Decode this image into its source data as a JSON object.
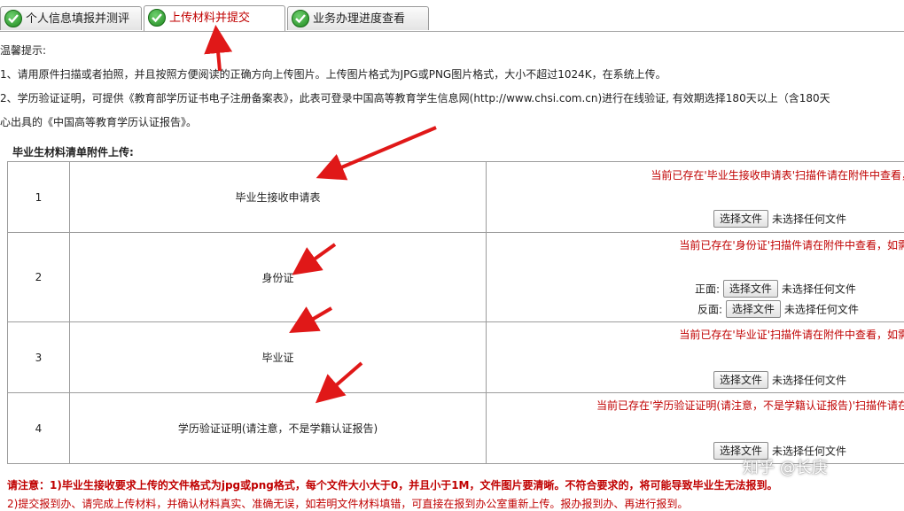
{
  "tabs": [
    {
      "label": "个人信息填报并测评",
      "active": false
    },
    {
      "label": "上传材料并提交",
      "active": true
    },
    {
      "label": "业务办理进度查看",
      "active": false
    }
  ],
  "notice": {
    "title": "温馨提示:",
    "line1": "1、请用原件扫描或者拍照，并且按照方便阅读的正确方向上传图片。上传图片格式为JPG或PNG图片格式，大小不超过1024K，在系统上传。",
    "line2": "2、学历验证证明，可提供《教育部学历证书电子注册备案表》，此表可登录中国高等教育学生信息网(http://www.chsi.com.cn)进行在线验证, 有效期选择180天以上（含180天",
    "line3": "心出具的《中国高等教育学历认证报告》。"
  },
  "section_title": "毕业生材料清单附件上传:",
  "rows": [
    {
      "num": "1",
      "name": "毕业生接收申请表",
      "exist": "当前已存在'毕业生接收申请表'扫描件请在附件中查看，",
      "button": "选择文件",
      "file": "未选择任何文件"
    },
    {
      "num": "2",
      "name": "身份证",
      "exist": "当前已存在'身份证'扫描件请在附件中查看，如需重",
      "front_label": "正面:",
      "back_label": "反面:",
      "button": "选择文件",
      "file": "未选择任何文件"
    },
    {
      "num": "3",
      "name": "毕业证",
      "exist": "当前已存在'毕业证'扫描件请在附件中查看，如需重",
      "button": "选择文件",
      "file": "未选择任何文件"
    },
    {
      "num": "4",
      "name": "学历验证证明(请注意，不是学籍认证报告)",
      "exist": "当前已存在'学历验证证明(请注意，不是学籍认证报告)'扫描件请在附",
      "button": "选择文件",
      "file": "未选择任何文件"
    }
  ],
  "warning": "请注意：1)毕业生接收要求上传的文件格式为jpg或png格式，每个文件大小大于0，并且小于1M，文件图片要清晰。不符合要求的，将可能导致毕业生无法报到。",
  "warning2": "2)提交报到办、请完成上传材料，并确认材料真实、准确无误，如若明文件材料填错，可直接在报到办公室重新上传。报办报到办、再进行报到。",
  "watermark": "知乎 @长庚",
  "colors": {
    "accent_red": "#c00000",
    "tab_check_green": "#2a9a2a",
    "arrow_red": "#e01818"
  }
}
